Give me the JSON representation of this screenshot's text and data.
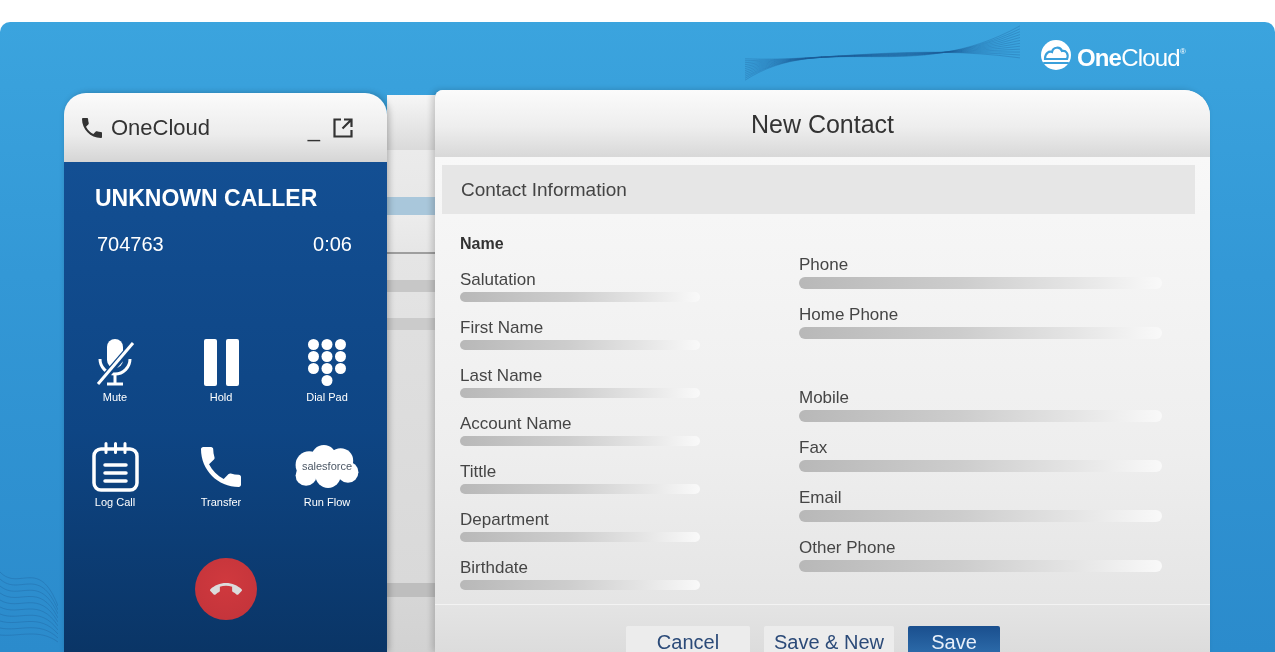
{
  "logo": {
    "text": "**One**Cloud$^{®}$"
  },
  "phone_panel": {
    "title": "OneCloud",
    "minimize_label": "_",
    "caller_name": "UNKNOWN CALLER",
    "caller_number": "704763",
    "call_duration": "0:06",
    "actions": [
      {
        "kind": "mute",
        "label": "Mute"
      },
      {
        "kind": "hold",
        "label": "Hold"
      },
      {
        "kind": "dial_pad",
        "label": "Dial Pad"
      },
      {
        "kind": "log_call",
        "label": "Log Call"
      },
      {
        "kind": "transfer",
        "label": "Transfer"
      },
      {
        "kind": "flow",
        "label": "Run Flow",
        "logo_text": "salesforce"
      }
    ]
  },
  "contact_form": {
    "title": "New Contact",
    "section": "Contact Information",
    "group_heading": "Name",
    "left_fields": [
      {
        "label": "Salutation"
      },
      {
        "label": "First Name"
      },
      {
        "label": "Last Name"
      },
      {
        "label": "Account Name"
      },
      {
        "label": "Tittle"
      },
      {
        "label": "Department"
      },
      {
        "label": "Birthdate"
      }
    ],
    "right_fields": [
      {
        "label": "Phone"
      },
      {
        "label": "Home Phone"
      },
      {
        "label": "Mobile"
      },
      {
        "label": "Fax"
      },
      {
        "label": "Email"
      },
      {
        "label": "Other Phone"
      }
    ],
    "buttons": [
      {
        "kind": "cancel",
        "label": "Cancel"
      },
      {
        "kind": "save_and_new",
        "label": "Save & New"
      },
      {
        "kind": "save",
        "label": "Save"
      }
    ]
  }
}
